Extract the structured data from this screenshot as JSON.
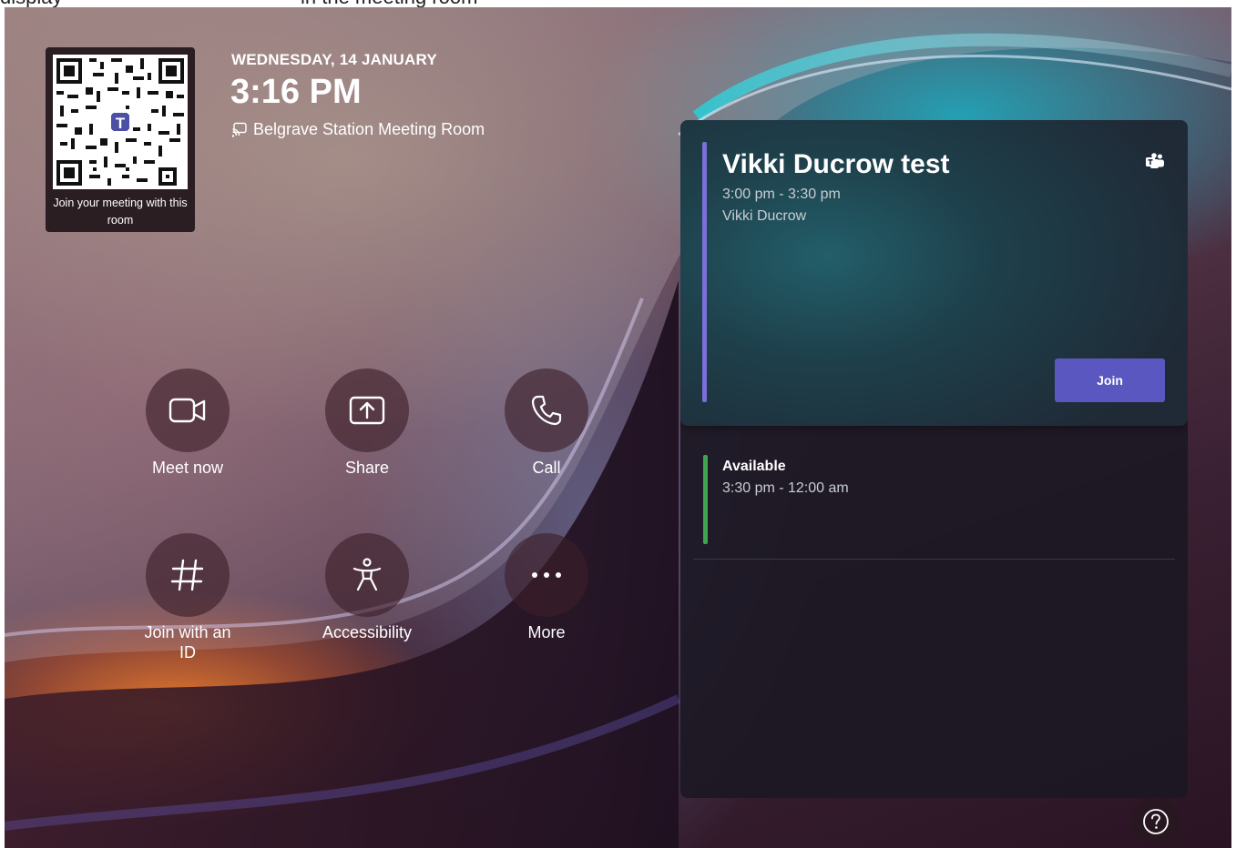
{
  "top_strip": {
    "text_left": "display",
    "text_right": "in the meeting room"
  },
  "qr": {
    "caption": "Join your meeting with this room"
  },
  "header": {
    "date": "WEDNESDAY, 14 JANUARY",
    "time": "3:16 PM",
    "room_name": "Belgrave Station Meeting Room",
    "room_icon": "cast-icon"
  },
  "actions": [
    {
      "label": "Meet now",
      "icon": "video-camera-icon"
    },
    {
      "label": "Share",
      "icon": "share-screen-icon"
    },
    {
      "label": "Call",
      "icon": "phone-icon"
    },
    {
      "label": "Join with an ID",
      "icon": "hash-icon"
    },
    {
      "label": "Accessibility",
      "icon": "accessibility-icon"
    },
    {
      "label": "More",
      "icon": "more-icon"
    }
  ],
  "meeting": {
    "title": "Vikki Ducrow test",
    "time": "3:00 pm - 3:30 pm",
    "organizer": "Vikki Ducrow",
    "join_label": "Join",
    "icon": "teams-icon"
  },
  "availability": {
    "title": "Available",
    "time": "3:30 pm - 12:00 am"
  },
  "help": {
    "icon": "help-icon"
  },
  "colors": {
    "join_button": "#5b57c0",
    "meeting_bar": "#7b6fd8",
    "available_bar": "#3fa54f"
  }
}
